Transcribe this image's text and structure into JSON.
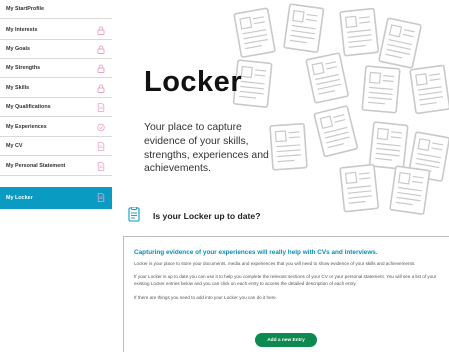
{
  "sidebar": {
    "items": [
      {
        "label": "My StartProfile",
        "icon": "none"
      },
      {
        "label": "My Interests",
        "icon": "lock-icon"
      },
      {
        "label": "My Goals",
        "icon": "lock-icon"
      },
      {
        "label": "My Strengths",
        "icon": "lock-icon"
      },
      {
        "label": "My Skills",
        "icon": "lock-icon"
      },
      {
        "label": "My Qualifications",
        "icon": "document-icon"
      },
      {
        "label": "My Experiences",
        "icon": "checkmark-circle-icon"
      },
      {
        "label": "My CV",
        "icon": "document-icon"
      },
      {
        "label": "My Personal Statement",
        "icon": "document-icon"
      },
      {
        "label": "My Locker",
        "icon": "document-icon",
        "active": true
      }
    ]
  },
  "hero": {
    "title": "Locker",
    "line1": "Your place to capture",
    "line2": "evidence of your skills,",
    "line3": "strengths, experiences and",
    "line4": "achievements."
  },
  "status": {
    "title": "Is your Locker up to date?"
  },
  "info": {
    "heading": "Capturing evidence of your experiences will really help with CVs and interviews.",
    "p1": "Locker is your place to store your documents, media and experiences that you will need to show evidence of your skills and achievements.",
    "p2": "If your Locker is up to date you can use it to help you complete the relevant sections of your CV or your personal statement. You will see a list of your existing Locker entries below and you can click on each entry to access the detailed description of each entry.",
    "p3": "If there are things you need to add into your Locker you can do it here.",
    "button": "Add a new Entry"
  },
  "colors": {
    "accent": "#0a9bc2",
    "heading": "#0a8eb5",
    "button": "#0d8a4f",
    "icon_pink": "#e9a3c9",
    "icon_line": "#c9c9c9"
  }
}
